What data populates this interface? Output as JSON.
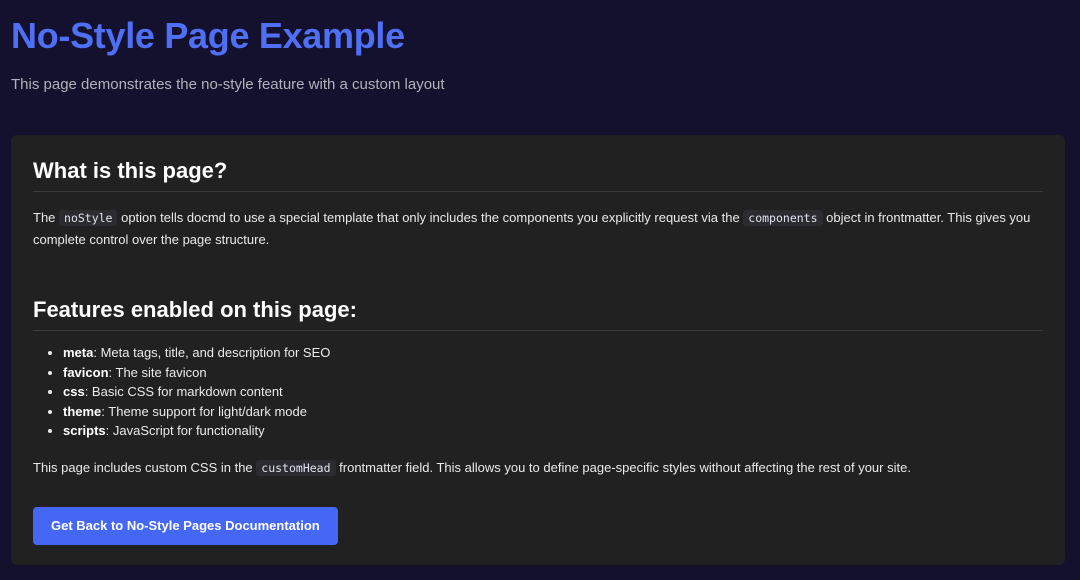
{
  "header": {
    "title": "No-Style Page Example",
    "subtitle": "This page demonstrates the no-style feature with a custom layout"
  },
  "card": {
    "section1": {
      "heading": "What is this page?",
      "para_prefix": "The ",
      "code_1": "noStyle",
      "para_middle": " option tells docmd to use a special template that only includes the components you explicitly request via the ",
      "code_2": "components",
      "para_suffix": " object in frontmatter. This gives you complete control over the page structure."
    },
    "section2": {
      "heading": "Features enabled on this page:",
      "features": [
        {
          "name": "meta",
          "desc": ": Meta tags, title, and description for SEO"
        },
        {
          "name": "favicon",
          "desc": ": The site favicon"
        },
        {
          "name": "css",
          "desc": ": Basic CSS for markdown content"
        },
        {
          "name": "theme",
          "desc": ": Theme support for light/dark mode"
        },
        {
          "name": "scripts",
          "desc": ": JavaScript for functionality"
        }
      ],
      "para_prefix": "This page includes custom CSS in the ",
      "code": "customHead",
      "para_suffix": " frontmatter field. This allows you to define page-specific styles without affecting the rest of your site."
    },
    "button_label": "Get Back to No-Style Pages Documentation"
  },
  "colors": {
    "page_background": "#14112e",
    "card_background": "#212121",
    "title_accent": "#4f6ff7",
    "button_background": "#4468f5"
  }
}
